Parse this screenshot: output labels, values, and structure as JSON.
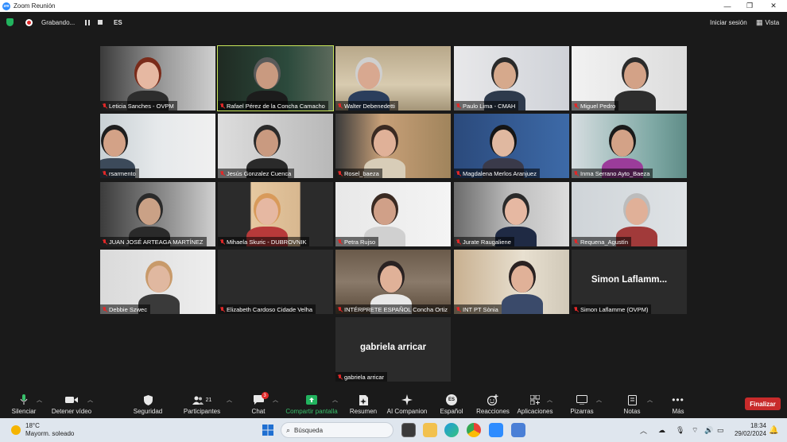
{
  "window": {
    "title": "Zoom Reunión",
    "minimize": "—",
    "maximize": "❐",
    "close": "✕"
  },
  "topbar": {
    "recording_label": "Grabando...",
    "language": "ES",
    "signin": "Iniciar sesión",
    "view": "Vista"
  },
  "participants": [
    {
      "name": "Leticia Sanches - OVPM"
    },
    {
      "name": "Rafael Pérez de la Concha Camacho"
    },
    {
      "name": "Walter Debenedetti"
    },
    {
      "name": "Paulo Lima - CMAH"
    },
    {
      "name": "Miguel Pedro"
    },
    {
      "name": "rsarmento"
    },
    {
      "name": "Jesús Gonzalez Cuenca"
    },
    {
      "name": "Rosel_baeza"
    },
    {
      "name": "Magdalena Merlos Aranjuez"
    },
    {
      "name": "Inma Serrano Ayto_Baeza"
    },
    {
      "name": "JUAN JOSÉ ARTEAGA MARTÍNEZ"
    },
    {
      "name": "Mihaela Skuric - DUBROVNIK"
    },
    {
      "name": "Petra Rujso"
    },
    {
      "name": "Jurate Raugaliene"
    },
    {
      "name": "Requena_Agustín"
    },
    {
      "name": "Debbie Szwec"
    },
    {
      "name": "Elizabeth Cardoso Cidade Velha"
    },
    {
      "name": "INTÉRPRETE ESPAÑOL Concha Ortiz"
    },
    {
      "name": "INT PT Sònia"
    },
    {
      "name": "Simon Laflamme (OVPM)",
      "display": "Simon  Laflamm..."
    },
    {
      "name": "gabriela arricar",
      "display": "gabriela arricar"
    }
  ],
  "toolbar": {
    "mute": "Silenciar",
    "stop_video": "Detener vídeo",
    "security": "Seguridad",
    "participants": "Participantes",
    "participants_count": "21",
    "chat": "Chat",
    "chat_badge": "3",
    "share": "Compartir pantalla",
    "summary": "Resumen",
    "ai": "AI Companion",
    "language": "Español",
    "language_badge": "ES",
    "reactions": "Reacciones",
    "apps": "Aplicaciones",
    "whiteboards": "Pizarras",
    "notes": "Notas",
    "more": "Más",
    "end": "Finalizar"
  },
  "taskbar": {
    "temperature": "18°C",
    "weather": "Mayorm. soleado",
    "search_placeholder": "Búsqueda",
    "time": "18:34",
    "date": "29/02/2024"
  },
  "colors": {
    "accent_green": "#22b35e",
    "end_red": "#c82b2b",
    "active_outline": "#c8e55a",
    "zoom_blue": "#2d8cff"
  }
}
